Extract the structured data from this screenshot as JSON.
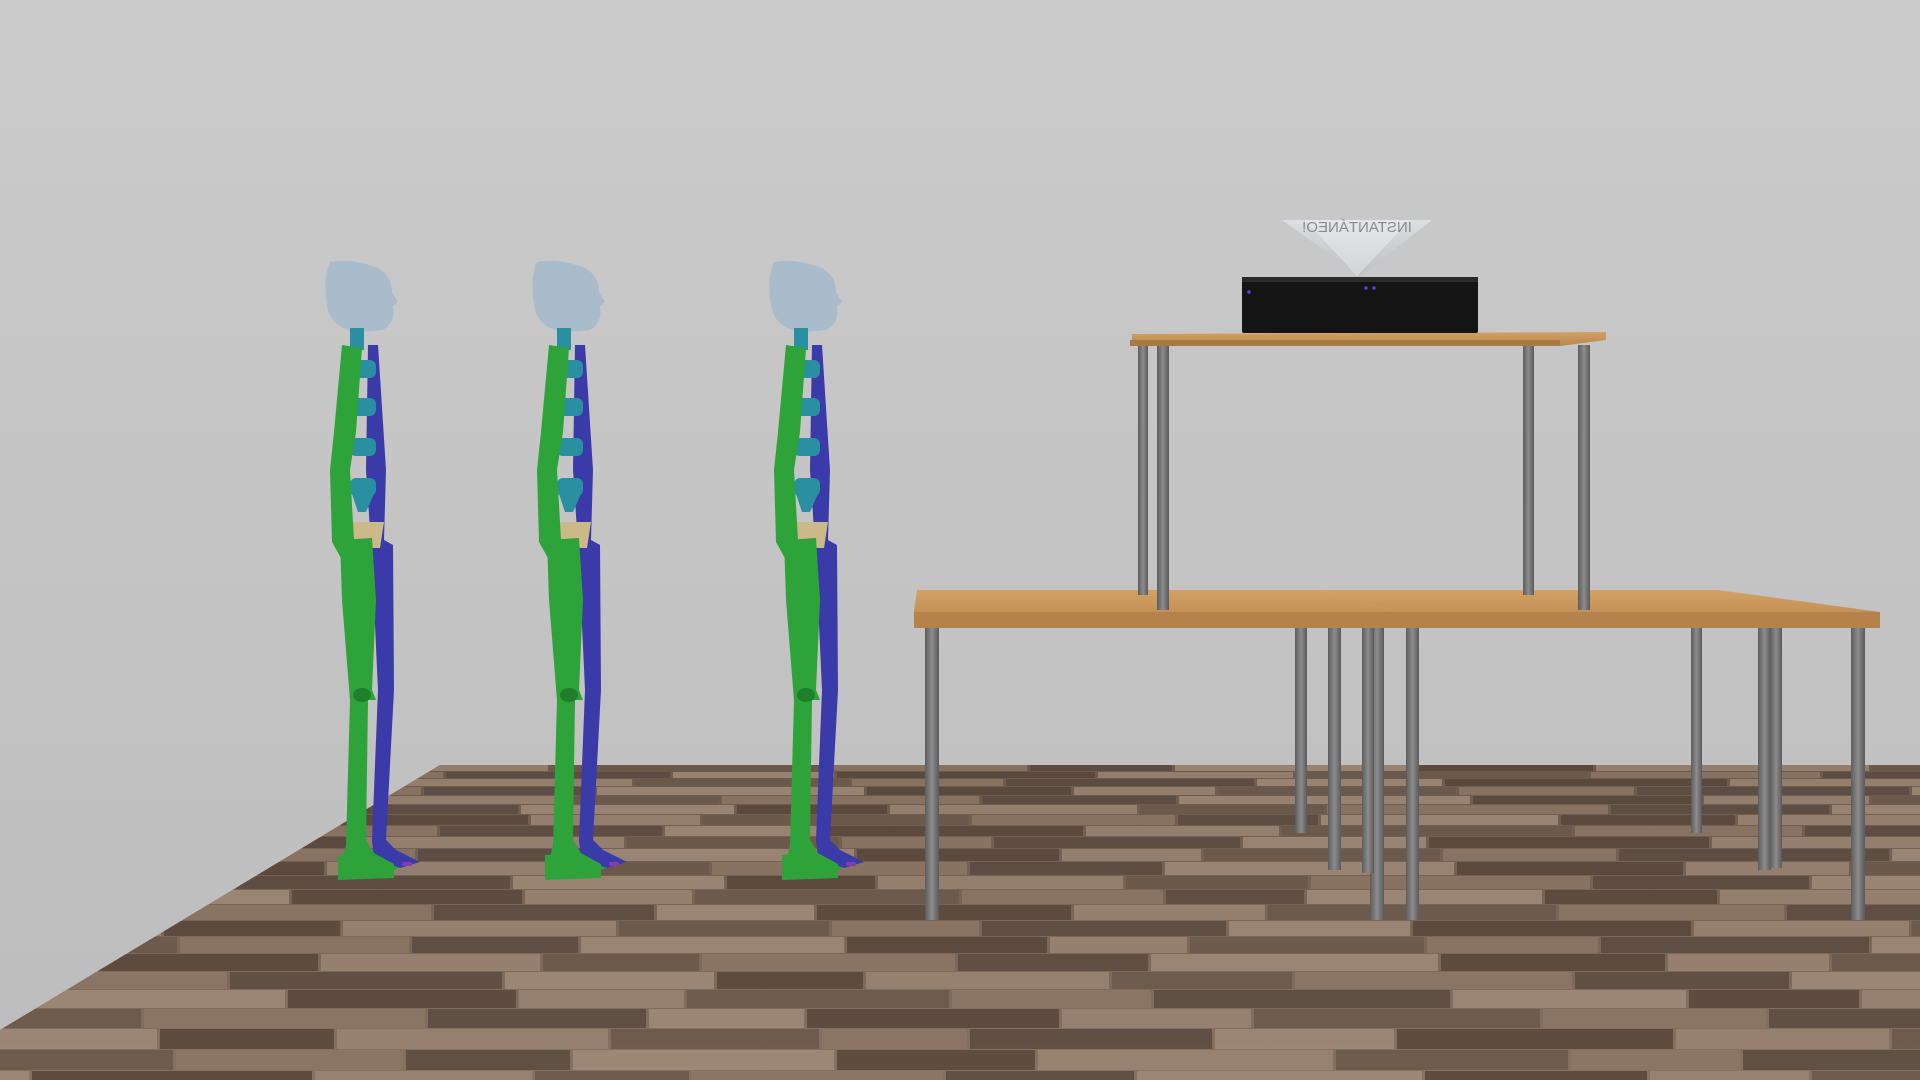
{
  "scene": {
    "hologram_text": "INSTANTÁNEO!",
    "colors": {
      "wall_top": "#c8c8c8",
      "wall_bottom": "#c0c0c0",
      "floor_base": "#7a6658",
      "floor_plank_light": "#a08a78",
      "floor_plank_dark": "#5b4a3f",
      "table_top": "#c9955a",
      "table_edge": "#a87943",
      "table_leg": "#7a7a7a",
      "box_black": "#141414",
      "hologram_glass": "#d9dde2",
      "mannequin_green": "#2ea33a",
      "mannequin_green_dark": "#1f7f2a",
      "mannequin_blue": "#3a3aa8",
      "mannequin_teal": "#2a8fa0",
      "mannequin_head": "#a9bccb",
      "mannequin_hip": "#cbb98a"
    }
  }
}
